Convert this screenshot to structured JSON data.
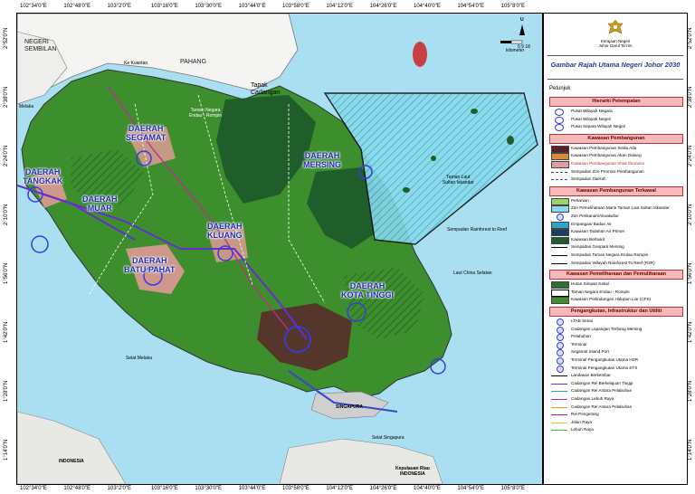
{
  "ticks": {
    "top": [
      "102°34'0\"E",
      "102°48'0\"E",
      "103°2'0\"E",
      "103°16'0\"E",
      "103°30'0\"E",
      "103°44'0\"E",
      "103°58'0\"E",
      "104°12'0\"E",
      "104°26'0\"E",
      "104°40'0\"E",
      "104°54'0\"E",
      "105°8'0\"E"
    ],
    "bottom": [
      "102°34'0\"E",
      "102°48'0\"E",
      "103°2'0\"E",
      "103°16'0\"E",
      "103°30'0\"E",
      "103°44'0\"E",
      "103°58'0\"E",
      "104°12'0\"E",
      "104°26'0\"E",
      "104°40'0\"E",
      "104°54'0\"E",
      "105°8'0\"E"
    ],
    "left": [
      "2°52'0\"N",
      "2°38'0\"N",
      "2°24'0\"N",
      "2°10'0\"N",
      "1°56'0\"N",
      "1°42'0\"N",
      "1°28'0\"N",
      "1°14'0\"N"
    ],
    "right": [
      "2°52'0\"N",
      "2°38'0\"N",
      "2°24'0\"N",
      "2°10'0\"N",
      "1°56'0\"N",
      "1°42'0\"N",
      "1°28'0\"N",
      "1°14'0\"N"
    ]
  },
  "map": {
    "states": {
      "negeri_sembilan": "NEGERI\nSEMBILAN",
      "pahang": "PAHANG",
      "melaka": "Melaka"
    },
    "tapak": "Tapak\nCadangan",
    "districts": [
      {
        "name": "DAERAH\nSEGAMAT"
      },
      {
        "name": "DAERAH\nTANGKAK"
      },
      {
        "name": "DAERAH\nMUAR"
      },
      {
        "name": "DAERAH\nKLUANG"
      },
      {
        "name": "DAERAH\nBATU PAHAT"
      },
      {
        "name": "DAERAH\nMERSING"
      },
      {
        "name": "DAERAH\nKOTA TINGGI"
      }
    ],
    "labels": {
      "ke_kuantan": "Ke Kuantan",
      "taman_endau": "Taman Negara\nEndau - Rompin",
      "taman_laut": "Taman Laut\nSultan Iskandar",
      "sempadan": "Sempadan Rainforest to Reef",
      "laut_china": "Laut China Selatan",
      "selat_melaka": "Selat Melaka",
      "singapura": "SINGAPURA",
      "selat_singapura": "Selat Singapura",
      "indonesia": "INDONESIA",
      "kepulauan_riau": "Kepulauan Riau\nINDONESIA"
    },
    "scale": {
      "labels": [
        "0",
        "9",
        "18"
      ],
      "unit": "kilometer",
      "north": "U"
    }
  },
  "panel": {
    "agency": "Kerajaan Negeri\nJohor Darul Ta'zim",
    "title": "Gambar Rajah Utama Negeri Johor 2030",
    "petunjuk": "Petunjuk",
    "sections": [
      {
        "title": "Hierarki Petempatan",
        "items": [
          "Pusat Wilayah Negara",
          "Pusat Wilayah Negeri",
          "Pusat Separa Wilayah Negeri"
        ]
      },
      {
        "title": "Kawasan Pembangunan",
        "items": [
          "Kawasan Pembangunan Sedia Ada",
          "Kawasan Pembangunan Akan Datang",
          "Kawasan Pembangunan Khas Ekonomi",
          "Sempadan Zon Promosi Pembangunan",
          "Sempadan Daerah"
        ]
      },
      {
        "title": "Kawasan Pembangunan Terkawal",
        "items": [
          "Pertanian",
          "Zon Pemeliharaan Marin Taman Laut Sultan Iskandar",
          "Zon Perikanan/Akuakultur",
          "Empangan/ Badan Air",
          "Kawasan Tadahan Air Primer",
          "Kawasan Berbukit",
          "Sempadan Geopark Mersing",
          "Sempadan Taman Negara Endau Rompin",
          "Sempadan Wilayah Rainforest To Reef (R2R)"
        ]
      },
      {
        "title": "Kawasan Pemeliharaan dan Pemuliharaan",
        "items": [
          "Hutan Simpan Kekal",
          "Taman Negara Endau - Rompin",
          "Kawasan Perlindungan Hidupan Liar (CFS)"
        ]
      },
      {
        "title": "Pengangkutan, Infrastruktur dan Utiliti",
        "items": [
          "LTAB Senai",
          "Cadangan Lapangan Terbang Mersing",
          "Pelabuhan",
          "Terminal",
          "Segamat Inland Port",
          "Terminal Pengangkutan Utama HSR",
          "Terminal Pengangkutan Utama ETS",
          "Landasan Berkembar",
          "Cadangan Rel Berkelajuan Tinggi",
          "Cadangan Rel Antara Pelabuhan",
          "Cadangan Lebuh Raya",
          "Cadangan Rel Antara Pelabuhan",
          "Rel Pengerang",
          "Jalan Raya",
          "Lebuh Raya"
        ]
      }
    ]
  },
  "colors": {
    "sea": "#a9dff0",
    "land_green": "#3c8f2c",
    "forest": "#1f5d2a",
    "pink": "#e79b9b",
    "urban": "#5a1f2a",
    "purple": "#7a1e8c",
    "district_text": "#1d2bb8",
    "title_blue": "#2a3a8f"
  }
}
